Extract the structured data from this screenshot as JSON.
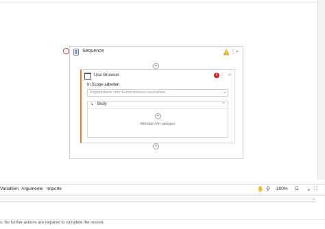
{
  "sequence": {
    "title": "Sequence",
    "icons": {
      "sequence": "sequence-icon",
      "warning": "warning-triangle-icon",
      "menu": "kebab-menu-icon",
      "collapse": "collapse-icon"
    }
  },
  "use_browser": {
    "title": "Use Browser",
    "scope_label": "In Scope arbeiten",
    "dropdown_placeholder": "Registerkarte zum Automatisieren auswählen",
    "body_title": "Body",
    "drop_hint": "Aktivität hier ablegen",
    "icons": {
      "window": "browser-window-icon",
      "error": "error-icon",
      "menu": "kebab-menu-icon",
      "collapse": "collapse-icon"
    },
    "error_glyph": "!"
  },
  "bottom_panel": {
    "tabs": [
      "Variablen",
      "Argumente",
      "Importe"
    ],
    "zoom": "100%",
    "icons": [
      "pan-hand-icon",
      "search-icon",
      "fit-to-screen-icon",
      "fullscreen-icon"
    ]
  },
  "status_message": "s. No further actions are required to complete the restore.",
  "colors": {
    "error": "#c62828",
    "warning": "#f0a020",
    "accent": "#e67e22"
  }
}
